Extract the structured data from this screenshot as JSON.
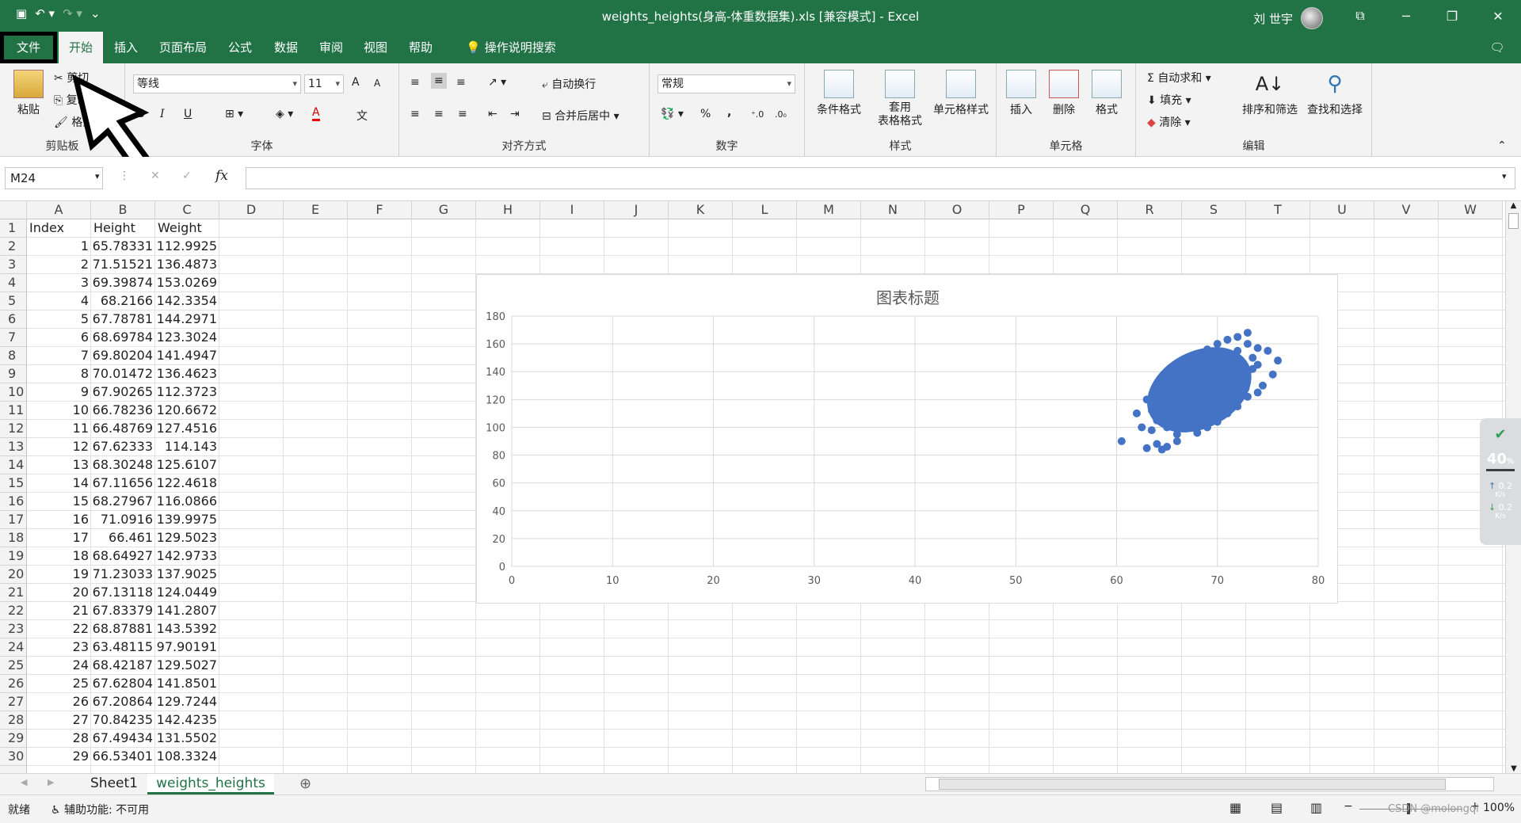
{
  "titlebar": {
    "title": "weights_heights(身高-体重数据集).xls  [兼容模式]  -  Excel",
    "user": "刘 世宇",
    "save_icon": "save-icon",
    "undo_icon": "undo-icon",
    "redo_icon": "redo-icon"
  },
  "tabs": [
    "文件",
    "开始",
    "插入",
    "页面布局",
    "公式",
    "数据",
    "审阅",
    "视图",
    "帮助"
  ],
  "tell_me": "操作说明搜索",
  "clipboard": {
    "paste": "粘贴",
    "cut": "剪切",
    "copy": "复制",
    "format_painter": "格式刷",
    "label": "剪贴板"
  },
  "font": {
    "name": "等线",
    "size": "11",
    "label": "字体",
    "bold": "B",
    "italic": "I",
    "underline": "U",
    "grow": "A",
    "shrink": "A",
    "color_a": "A",
    "wen": "文"
  },
  "alignment": {
    "wrap": "自动换行",
    "merge": "合并后居中",
    "label": "对齐方式"
  },
  "number": {
    "format": "常规",
    "percent": "%",
    "comma": ",",
    "label": "数字"
  },
  "styles": {
    "conditional": "条件格式",
    "table_l1": "套用",
    "table_l2": "表格格式",
    "cell_styles": "单元格样式",
    "label": "样式"
  },
  "cells": {
    "insert": "插入",
    "delete": "删除",
    "format": "格式",
    "label": "单元格"
  },
  "editing": {
    "autosum": "自动求和",
    "fill": "填充",
    "clear": "清除",
    "sort": "排序和筛选",
    "find": "查找和选择",
    "label": "编辑"
  },
  "namebox": "M24",
  "fx_label": "fx",
  "columns": [
    "A",
    "B",
    "C",
    "D",
    "E",
    "F",
    "G",
    "H",
    "I",
    "J",
    "K",
    "L",
    "M",
    "N",
    "O",
    "P",
    "Q",
    "R",
    "S",
    "T",
    "U",
    "V",
    "W"
  ],
  "rows": [
    {
      "n": "1",
      "a": "Index",
      "b": "Height",
      "c": "Weight"
    },
    {
      "n": "2",
      "a": "1",
      "b": "65.78331",
      "c": "112.9925"
    },
    {
      "n": "3",
      "a": "2",
      "b": "71.51521",
      "c": "136.4873"
    },
    {
      "n": "4",
      "a": "3",
      "b": "69.39874",
      "c": "153.0269"
    },
    {
      "n": "5",
      "a": "4",
      "b": "68.2166",
      "c": "142.3354"
    },
    {
      "n": "6",
      "a": "5",
      "b": "67.78781",
      "c": "144.2971"
    },
    {
      "n": "7",
      "a": "6",
      "b": "68.69784",
      "c": "123.3024"
    },
    {
      "n": "8",
      "a": "7",
      "b": "69.80204",
      "c": "141.4947"
    },
    {
      "n": "9",
      "a": "8",
      "b": "70.01472",
      "c": "136.4623"
    },
    {
      "n": "10",
      "a": "9",
      "b": "67.90265",
      "c": "112.3723"
    },
    {
      "n": "11",
      "a": "10",
      "b": "66.78236",
      "c": "120.6672"
    },
    {
      "n": "12",
      "a": "11",
      "b": "66.48769",
      "c": "127.4516"
    },
    {
      "n": "13",
      "a": "12",
      "b": "67.62333",
      "c": "114.143"
    },
    {
      "n": "14",
      "a": "13",
      "b": "68.30248",
      "c": "125.6107"
    },
    {
      "n": "15",
      "a": "14",
      "b": "67.11656",
      "c": "122.4618"
    },
    {
      "n": "16",
      "a": "15",
      "b": "68.27967",
      "c": "116.0866"
    },
    {
      "n": "17",
      "a": "16",
      "b": "71.0916",
      "c": "139.9975"
    },
    {
      "n": "18",
      "a": "17",
      "b": "66.461",
      "c": "129.5023"
    },
    {
      "n": "19",
      "a": "18",
      "b": "68.64927",
      "c": "142.9733"
    },
    {
      "n": "20",
      "a": "19",
      "b": "71.23033",
      "c": "137.9025"
    },
    {
      "n": "21",
      "a": "20",
      "b": "67.13118",
      "c": "124.0449"
    },
    {
      "n": "22",
      "a": "21",
      "b": "67.83379",
      "c": "141.2807"
    },
    {
      "n": "23",
      "a": "22",
      "b": "68.87881",
      "c": "143.5392"
    },
    {
      "n": "24",
      "a": "23",
      "b": "63.48115",
      "c": "97.90191"
    },
    {
      "n": "25",
      "a": "24",
      "b": "68.42187",
      "c": "129.5027"
    },
    {
      "n": "26",
      "a": "25",
      "b": "67.62804",
      "c": "141.8501"
    },
    {
      "n": "27",
      "a": "26",
      "b": "67.20864",
      "c": "129.7244"
    },
    {
      "n": "28",
      "a": "27",
      "b": "70.84235",
      "c": "142.4235"
    },
    {
      "n": "29",
      "a": "28",
      "b": "67.49434",
      "c": "131.5502"
    },
    {
      "n": "30",
      "a": "29",
      "b": "66.53401",
      "c": "108.3324"
    }
  ],
  "chart_data": {
    "type": "scatter",
    "title": "图表标题",
    "xlim": [
      0,
      80
    ],
    "ylim": [
      0,
      180
    ],
    "xticks": [
      0,
      10,
      20,
      30,
      40,
      50,
      60,
      70,
      80
    ],
    "yticks": [
      0,
      20,
      40,
      60,
      80,
      100,
      120,
      140,
      160,
      180
    ],
    "grid": true,
    "marker_color": "#4472C4",
    "points": [
      [
        65.78331,
        112.9925
      ],
      [
        71.51521,
        136.4873
      ],
      [
        69.39874,
        153.0269
      ],
      [
        68.2166,
        142.3354
      ],
      [
        67.78781,
        144.2971
      ],
      [
        68.69784,
        123.3024
      ],
      [
        69.80204,
        141.4947
      ],
      [
        70.01472,
        136.4623
      ],
      [
        67.90265,
        112.3723
      ],
      [
        66.78236,
        120.6672
      ],
      [
        66.48769,
        127.4516
      ],
      [
        67.62333,
        114.143
      ],
      [
        68.30248,
        125.6107
      ],
      [
        67.11656,
        122.4618
      ],
      [
        68.27967,
        116.0866
      ],
      [
        71.0916,
        139.9975
      ],
      [
        66.461,
        129.5023
      ],
      [
        68.64927,
        142.9733
      ],
      [
        71.23033,
        137.9025
      ],
      [
        67.13118,
        124.0449
      ],
      [
        67.83379,
        141.2807
      ],
      [
        68.87881,
        143.5392
      ],
      [
        63.48115,
        97.90191
      ],
      [
        68.42187,
        129.5027
      ],
      [
        67.62804,
        141.8501
      ],
      [
        67.20864,
        129.7244
      ],
      [
        70.84235,
        142.4235
      ],
      [
        67.49434,
        131.5502
      ],
      [
        66.53401,
        108.3324
      ],
      [
        60.5,
        90
      ],
      [
        63,
        85
      ],
      [
        64,
        88
      ],
      [
        64.5,
        84
      ],
      [
        65,
        86
      ],
      [
        66,
        90
      ],
      [
        62,
        110
      ],
      [
        62.5,
        100
      ],
      [
        63,
        120
      ],
      [
        64,
        128
      ],
      [
        65,
        135
      ],
      [
        66,
        140
      ],
      [
        67,
        146
      ],
      [
        68,
        150
      ],
      [
        69,
        156
      ],
      [
        70,
        160
      ],
      [
        71,
        163
      ],
      [
        72,
        165
      ],
      [
        73,
        168
      ],
      [
        73.5,
        150
      ],
      [
        74,
        157
      ],
      [
        75,
        155
      ],
      [
        76,
        148
      ],
      [
        75.5,
        138
      ],
      [
        74.5,
        130
      ],
      [
        74,
        125
      ],
      [
        73,
        122
      ],
      [
        72,
        115
      ],
      [
        71,
        110
      ],
      [
        70,
        104
      ],
      [
        69,
        100
      ],
      [
        68,
        96
      ],
      [
        66,
        95
      ],
      [
        65,
        100
      ],
      [
        64,
        105
      ],
      [
        63.5,
        112
      ],
      [
        64,
        116
      ],
      [
        65,
        122
      ],
      [
        66,
        130
      ],
      [
        67,
        138
      ],
      [
        68,
        145
      ],
      [
        69,
        148
      ],
      [
        70,
        150
      ],
      [
        71,
        152
      ],
      [
        72,
        155
      ],
      [
        73,
        160
      ],
      [
        74,
        145
      ],
      [
        73,
        140
      ],
      [
        72,
        135
      ],
      [
        71,
        130
      ],
      [
        70,
        125
      ],
      [
        69,
        118
      ],
      [
        68,
        110
      ],
      [
        67,
        105
      ],
      [
        66,
        102
      ],
      [
        65,
        108
      ],
      [
        65.5,
        115
      ],
      [
        66.5,
        118
      ],
      [
        67.5,
        125
      ],
      [
        68.5,
        132
      ],
      [
        69.5,
        138
      ],
      [
        70.5,
        142
      ],
      [
        71.5,
        148
      ],
      [
        72.5,
        146
      ],
      [
        73.5,
        142
      ],
      [
        72.8,
        128
      ],
      [
        71.8,
        120
      ],
      [
        70.8,
        116
      ],
      [
        69.8,
        112
      ],
      [
        68.8,
        106
      ]
    ]
  },
  "sheets": [
    "Sheet1",
    "weights_heights"
  ],
  "status": {
    "ready": "就绪",
    "accessibility": "辅助功能: 不可用",
    "zoom": "100%"
  },
  "widget": {
    "value": "40",
    "unit": "%",
    "up": "0.2",
    "down": "0.2",
    "rate_unit": "K/s"
  },
  "watermark": "CSDN @molongqi"
}
